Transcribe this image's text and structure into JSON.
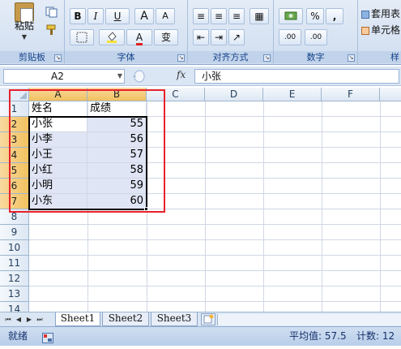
{
  "ribbon": {
    "clipboard": {
      "paste_label": "粘贴",
      "group_label": "剪贴板"
    },
    "font": {
      "group_label": "字体",
      "bold": "B",
      "italic": "I",
      "underline": "U",
      "grow": "A",
      "shrink": "A",
      "font_color": "A",
      "phonetic": "变"
    },
    "alignment": {
      "group_label": "对齐方式"
    },
    "number": {
      "group_label": "数字",
      "percent": "%",
      "comma": ",",
      "inc_decimal": ".00",
      "dec_decimal": ".00"
    },
    "styles": {
      "format_table": "套用表",
      "cell_styles": "单元格",
      "group_label": "样"
    }
  },
  "formula_bar": {
    "name_box": "A2",
    "fx": "fx",
    "formula": "小张"
  },
  "columns": [
    "A",
    "B",
    "C",
    "D",
    "E",
    "F"
  ],
  "rows": [
    "1",
    "2",
    "3",
    "4",
    "5",
    "6",
    "7",
    "8",
    "9",
    "10",
    "11",
    "12",
    "13",
    "14"
  ],
  "table": {
    "headers": [
      "姓名",
      "成绩"
    ],
    "data": [
      [
        "小张",
        "55"
      ],
      [
        "小李",
        "56"
      ],
      [
        "小王",
        "57"
      ],
      [
        "小红",
        "58"
      ],
      [
        "小明",
        "59"
      ],
      [
        "小东",
        "60"
      ]
    ]
  },
  "sheets": [
    "Sheet1",
    "Sheet2",
    "Sheet3"
  ],
  "status": {
    "mode": "就绪",
    "average": "平均值: 57.5",
    "count": "计数: 12"
  },
  "colors": {
    "accent": "#15428b",
    "selection_header": "#f1c15f",
    "highlight": "#e8212b"
  }
}
